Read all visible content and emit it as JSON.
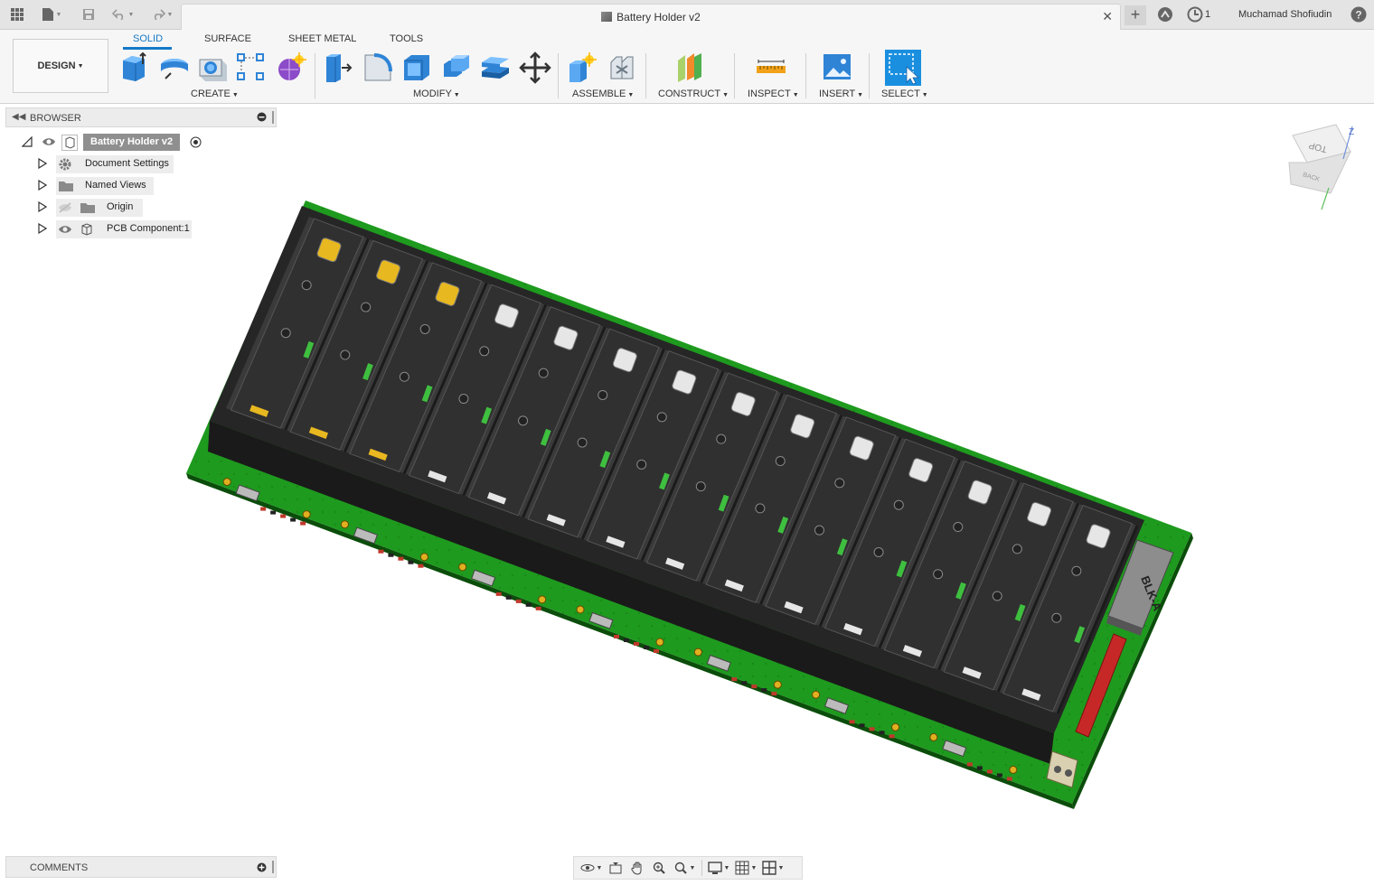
{
  "titlebar": {
    "document_title": "Battery Holder v2",
    "close_symbol": "✕",
    "new_tab_symbol": "+",
    "jobs_count": "1",
    "user_name": "Muchamad Shofiudin",
    "help_symbol": "?"
  },
  "ribbon": {
    "workspace_button": "DESIGN",
    "tabs": [
      "SOLID",
      "SURFACE",
      "SHEET METAL",
      "TOOLS"
    ],
    "active_tab": "SOLID",
    "groups": {
      "create": "CREATE",
      "modify": "MODIFY",
      "assemble": "ASSEMBLE",
      "construct": "CONSTRUCT",
      "inspect": "INSPECT",
      "insert": "INSERT",
      "select": "SELECT"
    },
    "accent_color": "#1479c9"
  },
  "browser": {
    "title": "BROWSER",
    "root": "Battery Holder v2",
    "items": [
      {
        "label": "Document Settings",
        "icon": "gear-icon"
      },
      {
        "label": "Named Views",
        "icon": "folder-icon"
      },
      {
        "label": "Origin",
        "icon": "folder-icon",
        "hidden": true
      },
      {
        "label": "PCB Component:1",
        "icon": "component-icon"
      }
    ]
  },
  "viewcube": {
    "top_face": "TOP",
    "side_face": "BACK",
    "axis_z": "Z"
  },
  "model": {
    "connector_label": "BLK-A",
    "cells": 14,
    "pcb_color": "#1e9a1e",
    "holder_color": "#2e2e2e"
  },
  "comments": {
    "title": "COMMENTS"
  }
}
